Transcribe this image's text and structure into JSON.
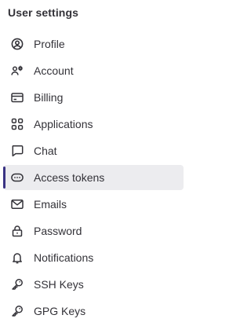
{
  "sidebar": {
    "title": "User settings",
    "items": [
      {
        "label": "Profile",
        "icon": "profile-icon",
        "active": false
      },
      {
        "label": "Account",
        "icon": "account-icon",
        "active": false
      },
      {
        "label": "Billing",
        "icon": "billing-icon",
        "active": false
      },
      {
        "label": "Applications",
        "icon": "applications-icon",
        "active": false
      },
      {
        "label": "Chat",
        "icon": "chat-icon",
        "active": false
      },
      {
        "label": "Access tokens",
        "icon": "token-icon",
        "active": true
      },
      {
        "label": "Emails",
        "icon": "mail-icon",
        "active": false
      },
      {
        "label": "Password",
        "icon": "lock-icon",
        "active": false
      },
      {
        "label": "Notifications",
        "icon": "bell-icon",
        "active": false
      },
      {
        "label": "SSH Keys",
        "icon": "key-icon",
        "active": false
      },
      {
        "label": "GPG Keys",
        "icon": "key-icon",
        "active": false
      }
    ]
  },
  "colors": {
    "text": "#333238",
    "active_background": "#ececef",
    "active_indicator": "#3a3383"
  }
}
